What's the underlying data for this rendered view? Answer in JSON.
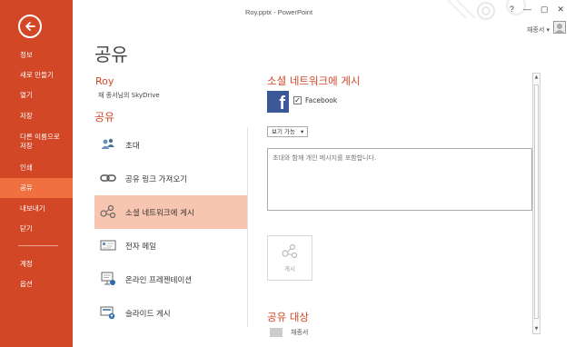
{
  "window": {
    "title": "Roy.pptx - PowerPoint",
    "help": "?",
    "minimize": "—",
    "restore": "▢",
    "close": "✕",
    "user_name": "채종서 ▾"
  },
  "sidebar": {
    "back_icon": "back-arrow-icon",
    "items": [
      {
        "label": "정보"
      },
      {
        "label": "새로 만들기"
      },
      {
        "label": "열기"
      },
      {
        "label": "저장"
      },
      {
        "label": "다른 이름으로\n저장"
      },
      {
        "label": "인쇄"
      },
      {
        "label": "공유"
      },
      {
        "label": "내보내기"
      },
      {
        "label": "닫기"
      },
      {
        "label": "계정"
      },
      {
        "label": "옵션"
      }
    ],
    "active_index": 6,
    "colors": {
      "background": "#d24726",
      "active": "#f0703f"
    }
  },
  "page": {
    "title": "공유",
    "doc_name": "Roy",
    "doc_location": "채 종서님의 SkyDrive",
    "share_heading": "공유"
  },
  "share_options": [
    {
      "label": "초대",
      "icon": "invite-people-icon"
    },
    {
      "label": "공유 링크 가져오기",
      "icon": "link-icon"
    },
    {
      "label": "소셜 네트워크에 게시",
      "icon": "social-network-icon",
      "selected": true
    },
    {
      "label": "전자 메일",
      "icon": "email-icon"
    },
    {
      "label": "온라인 프레젠테이션",
      "icon": "online-presentation-icon"
    },
    {
      "label": "슬라이드 게시",
      "icon": "publish-slides-icon"
    }
  ],
  "social": {
    "heading": "소셜 네트워크에 게시",
    "facebook_logo": "f",
    "facebook_checked": "✓",
    "facebook_label": "Facebook",
    "visibility_value": "보기 가능",
    "visibility_arrow": "▾",
    "message_placeholder": "초대와 함께 개인 메시지를 포함합니다.",
    "post_button_label": "게시",
    "recipients_heading": "공유 대상",
    "recipient_name": "채종서"
  },
  "scroll": {
    "up": "▲",
    "down": "▼"
  },
  "colors": {
    "accent": "#d24726",
    "selected_bg": "#f8c6b0",
    "facebook": "#3b5998"
  }
}
